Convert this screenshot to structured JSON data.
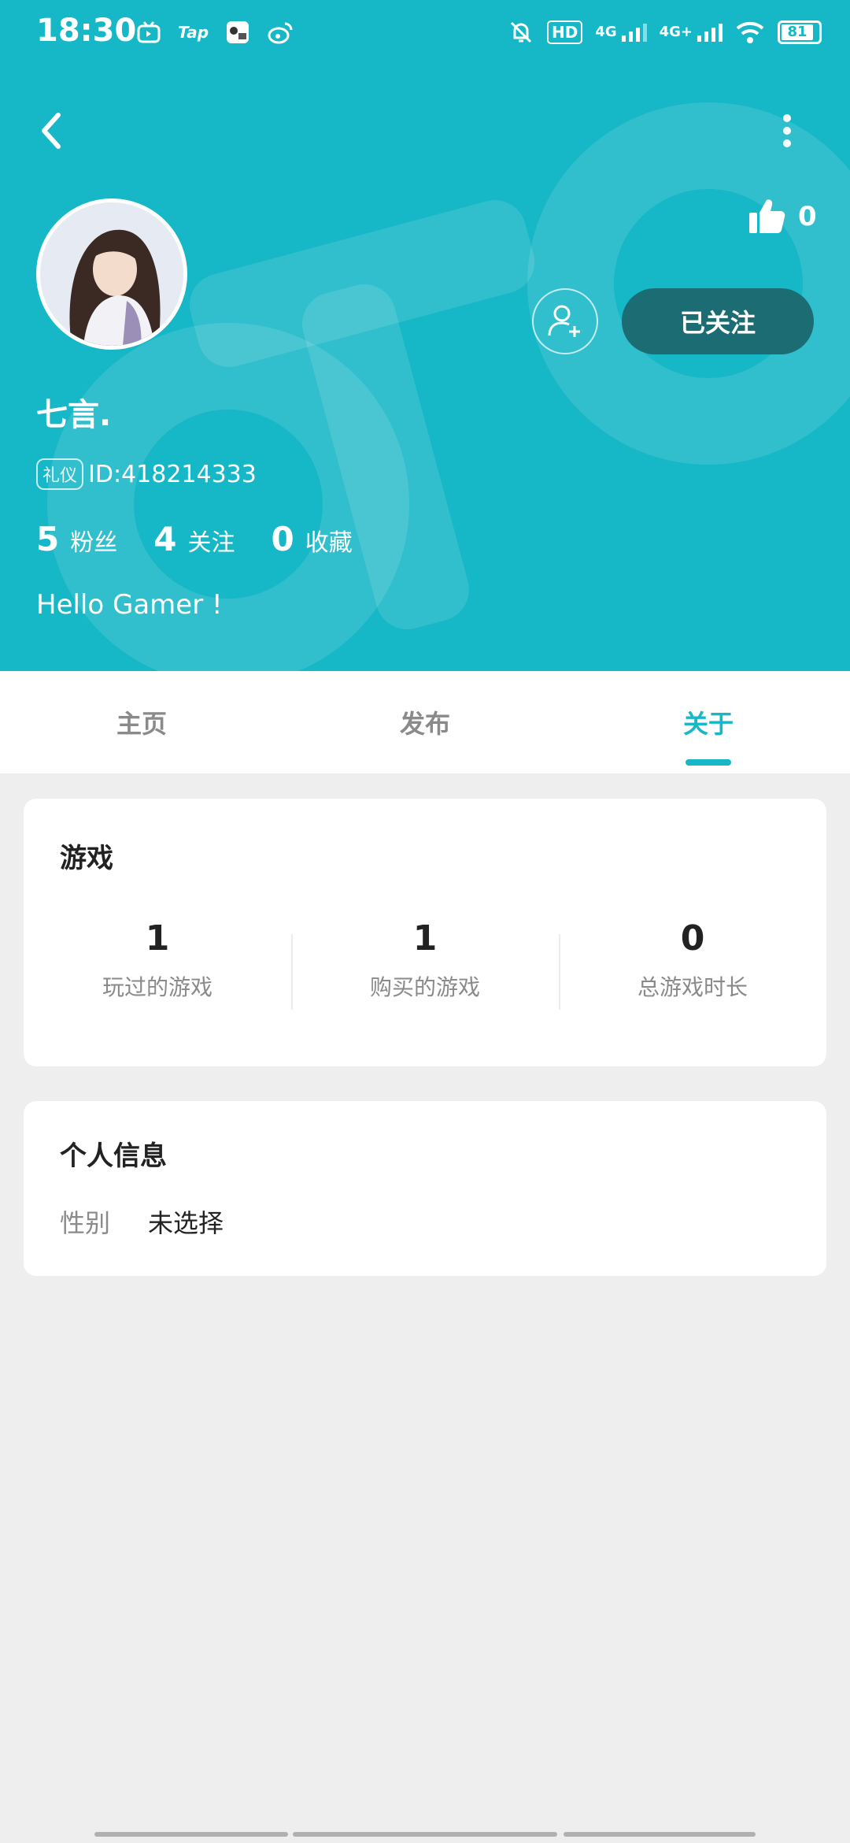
{
  "status_bar": {
    "time": "18:30",
    "tap_label": "Tap",
    "hd_label": "HD",
    "net1": "4G",
    "net2": "4G+",
    "battery": "81"
  },
  "profile": {
    "username": "七言.",
    "badge": "礼仪",
    "id_text": "ID:418214333",
    "likes": "0",
    "follow_label": "已关注",
    "bio": "Hello Gamer !",
    "stats": [
      {
        "num": "5",
        "label": "粉丝"
      },
      {
        "num": "4",
        "label": "关注"
      },
      {
        "num": "0",
        "label": "收藏"
      }
    ]
  },
  "tabs": [
    {
      "label": "主页"
    },
    {
      "label": "发布"
    },
    {
      "label": "关于"
    }
  ],
  "games_card": {
    "title": "游戏",
    "stats": [
      {
        "num": "1",
        "label": "玩过的游戏"
      },
      {
        "num": "1",
        "label": "购买的游戏"
      },
      {
        "num": "0",
        "label": "总游戏时长"
      }
    ]
  },
  "info_card": {
    "title": "个人信息",
    "rows": [
      {
        "key": "性别",
        "value": "未选择"
      }
    ]
  },
  "colors": {
    "accent": "#16b7c6",
    "follow_button": "#1c6d73",
    "background": "#eeeeee"
  }
}
